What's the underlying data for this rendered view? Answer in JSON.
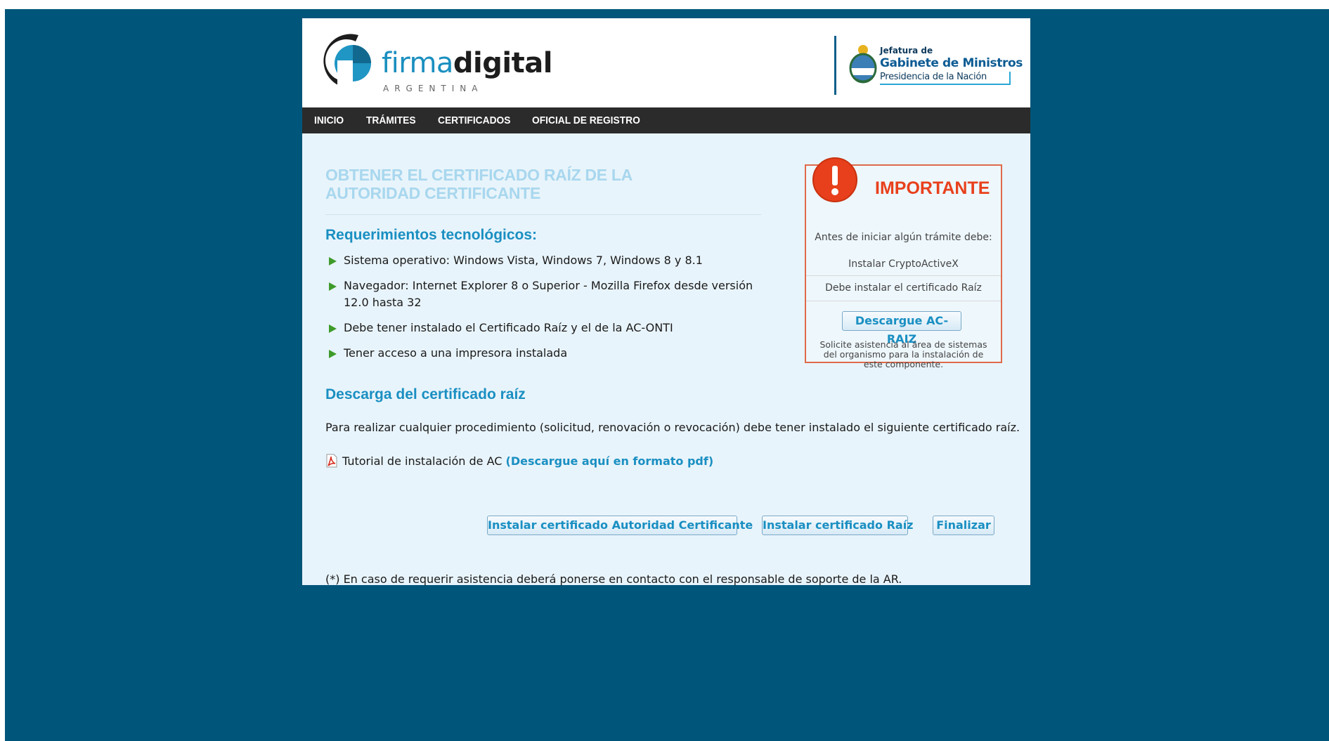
{
  "header": {
    "logo": {
      "light": "firma",
      "bold": "digital",
      "sub": "ARGENTINA"
    },
    "gob": {
      "small": "Jefatura de",
      "big": "Gabinete de Ministros",
      "pres": "Presidencia de la Nación"
    }
  },
  "nav": {
    "items": [
      "INICIO",
      "TRÁMITES",
      "CERTIFICADOS",
      "OFICIAL DE REGISTRO"
    ]
  },
  "main": {
    "title": "OBTENER EL CERTIFICADO RAÍZ DE LA AUTORIDAD CERTIFICANTE",
    "req_heading": "Requerimientos tecnológicos:",
    "requirements": [
      "Sistema operativo: Windows Vista, Windows 7, Windows 8 y 8.1",
      "Navegador: Internet Explorer 8 o Superior - Mozilla Firefox desde versión 12.0 hasta 32",
      "Debe tener instalado el Certificado Raíz y el de la AC-ONTI",
      "Tener acceso a una impresora instalada"
    ],
    "download_heading": "Descarga del certificado raíz",
    "download_text": "Para realizar cualquier procedimiento (solicitud, renovación o revocación) debe tener instalado el siguiente certificado raíz.",
    "tutorial_text": "Tutorial de instalación de AC",
    "tutorial_link": "(Descargue aquí en formato pdf)",
    "buttons": {
      "install_ac": "Instalar certificado Autoridad Certificante",
      "install_raiz": "Instalar certificado Raíz",
      "finish": "Finalizar"
    },
    "footnote": "(*) En caso de requerir asistencia deberá ponerse en contacto con el responsable de soporte de la AR."
  },
  "important": {
    "title": "IMPORTANTE",
    "intro": "Antes de iniciar algún trámite debe:",
    "item1": "Instalar CryptoActiveX",
    "item2": "Debe instalar el certificado Raíz",
    "button": "Descargue AC-RAIZ",
    "note": "Solicite asistencia al área de sistemas del organismo para la instalación de este componente."
  },
  "colors": {
    "background": "#00557a",
    "nav": "#2b2b2b",
    "content": "#e8f4fb",
    "accent": "#1a8fc2",
    "important": "#e8401c"
  }
}
